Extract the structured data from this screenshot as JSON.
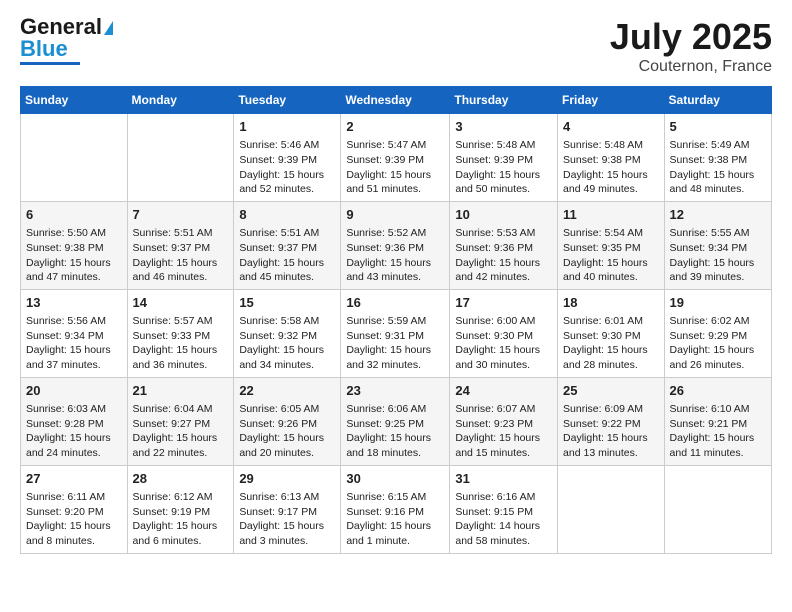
{
  "header": {
    "logo_line1": "General",
    "logo_line2": "Blue",
    "month": "July 2025",
    "location": "Couternon, France"
  },
  "days_of_week": [
    "Sunday",
    "Monday",
    "Tuesday",
    "Wednesday",
    "Thursday",
    "Friday",
    "Saturday"
  ],
  "weeks": [
    [
      {
        "day": "",
        "info": ""
      },
      {
        "day": "",
        "info": ""
      },
      {
        "day": "1",
        "info": "Sunrise: 5:46 AM\nSunset: 9:39 PM\nDaylight: 15 hours and 52 minutes."
      },
      {
        "day": "2",
        "info": "Sunrise: 5:47 AM\nSunset: 9:39 PM\nDaylight: 15 hours and 51 minutes."
      },
      {
        "day": "3",
        "info": "Sunrise: 5:48 AM\nSunset: 9:39 PM\nDaylight: 15 hours and 50 minutes."
      },
      {
        "day": "4",
        "info": "Sunrise: 5:48 AM\nSunset: 9:38 PM\nDaylight: 15 hours and 49 minutes."
      },
      {
        "day": "5",
        "info": "Sunrise: 5:49 AM\nSunset: 9:38 PM\nDaylight: 15 hours and 48 minutes."
      }
    ],
    [
      {
        "day": "6",
        "info": "Sunrise: 5:50 AM\nSunset: 9:38 PM\nDaylight: 15 hours and 47 minutes."
      },
      {
        "day": "7",
        "info": "Sunrise: 5:51 AM\nSunset: 9:37 PM\nDaylight: 15 hours and 46 minutes."
      },
      {
        "day": "8",
        "info": "Sunrise: 5:51 AM\nSunset: 9:37 PM\nDaylight: 15 hours and 45 minutes."
      },
      {
        "day": "9",
        "info": "Sunrise: 5:52 AM\nSunset: 9:36 PM\nDaylight: 15 hours and 43 minutes."
      },
      {
        "day": "10",
        "info": "Sunrise: 5:53 AM\nSunset: 9:36 PM\nDaylight: 15 hours and 42 minutes."
      },
      {
        "day": "11",
        "info": "Sunrise: 5:54 AM\nSunset: 9:35 PM\nDaylight: 15 hours and 40 minutes."
      },
      {
        "day": "12",
        "info": "Sunrise: 5:55 AM\nSunset: 9:34 PM\nDaylight: 15 hours and 39 minutes."
      }
    ],
    [
      {
        "day": "13",
        "info": "Sunrise: 5:56 AM\nSunset: 9:34 PM\nDaylight: 15 hours and 37 minutes."
      },
      {
        "day": "14",
        "info": "Sunrise: 5:57 AM\nSunset: 9:33 PM\nDaylight: 15 hours and 36 minutes."
      },
      {
        "day": "15",
        "info": "Sunrise: 5:58 AM\nSunset: 9:32 PM\nDaylight: 15 hours and 34 minutes."
      },
      {
        "day": "16",
        "info": "Sunrise: 5:59 AM\nSunset: 9:31 PM\nDaylight: 15 hours and 32 minutes."
      },
      {
        "day": "17",
        "info": "Sunrise: 6:00 AM\nSunset: 9:30 PM\nDaylight: 15 hours and 30 minutes."
      },
      {
        "day": "18",
        "info": "Sunrise: 6:01 AM\nSunset: 9:30 PM\nDaylight: 15 hours and 28 minutes."
      },
      {
        "day": "19",
        "info": "Sunrise: 6:02 AM\nSunset: 9:29 PM\nDaylight: 15 hours and 26 minutes."
      }
    ],
    [
      {
        "day": "20",
        "info": "Sunrise: 6:03 AM\nSunset: 9:28 PM\nDaylight: 15 hours and 24 minutes."
      },
      {
        "day": "21",
        "info": "Sunrise: 6:04 AM\nSunset: 9:27 PM\nDaylight: 15 hours and 22 minutes."
      },
      {
        "day": "22",
        "info": "Sunrise: 6:05 AM\nSunset: 9:26 PM\nDaylight: 15 hours and 20 minutes."
      },
      {
        "day": "23",
        "info": "Sunrise: 6:06 AM\nSunset: 9:25 PM\nDaylight: 15 hours and 18 minutes."
      },
      {
        "day": "24",
        "info": "Sunrise: 6:07 AM\nSunset: 9:23 PM\nDaylight: 15 hours and 15 minutes."
      },
      {
        "day": "25",
        "info": "Sunrise: 6:09 AM\nSunset: 9:22 PM\nDaylight: 15 hours and 13 minutes."
      },
      {
        "day": "26",
        "info": "Sunrise: 6:10 AM\nSunset: 9:21 PM\nDaylight: 15 hours and 11 minutes."
      }
    ],
    [
      {
        "day": "27",
        "info": "Sunrise: 6:11 AM\nSunset: 9:20 PM\nDaylight: 15 hours and 8 minutes."
      },
      {
        "day": "28",
        "info": "Sunrise: 6:12 AM\nSunset: 9:19 PM\nDaylight: 15 hours and 6 minutes."
      },
      {
        "day": "29",
        "info": "Sunrise: 6:13 AM\nSunset: 9:17 PM\nDaylight: 15 hours and 3 minutes."
      },
      {
        "day": "30",
        "info": "Sunrise: 6:15 AM\nSunset: 9:16 PM\nDaylight: 15 hours and 1 minute."
      },
      {
        "day": "31",
        "info": "Sunrise: 6:16 AM\nSunset: 9:15 PM\nDaylight: 14 hours and 58 minutes."
      },
      {
        "day": "",
        "info": ""
      },
      {
        "day": "",
        "info": ""
      }
    ]
  ]
}
